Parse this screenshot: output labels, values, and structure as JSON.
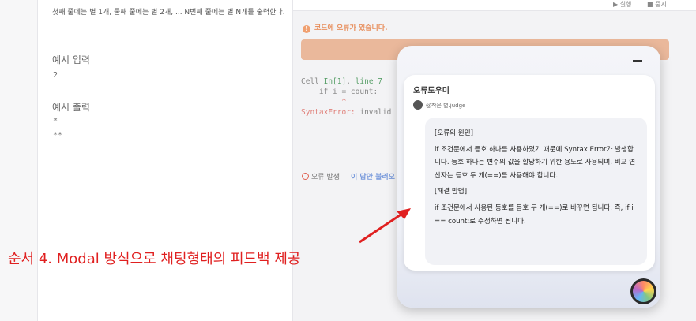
{
  "problem": {
    "description": "첫째 줄에는 별 1개, 둘째 줄에는 별 2개, ... N번째 줄에는 별 N개를 출력한다.",
    "example_input_title": "예시 입력",
    "example_input_value": "2",
    "example_output_title": "예시 출력",
    "example_output_line1": "*",
    "example_output_line2": "**"
  },
  "editor": {
    "run_label": "▶ 실행",
    "stop_label": "■ 중지",
    "error_header": "코드에 오류가 있습니다.",
    "console_line1": "Cell In[1], line 7",
    "console_line2": "    if i = count:",
    "console_line3": "         ^",
    "console_line4_prefix": "SyntaxError:",
    "console_line4_rest": " invalid",
    "error_chip": "오류 발생",
    "ai_link": "이 답안 불러오"
  },
  "modal": {
    "title": "오류도우미",
    "author": "@착은 별.judge",
    "cause_heading": "[오류의 원인]",
    "cause_text": "if 조건문에서 등호 하나를 사용하였기 때문에 Syntax Error가 발생합니다. 등호 하나는 변수의 값을 할당하기 위한 용도로 사용되며, 비교 연산자는 등호 두 개(==)를 사용해야 합니다.",
    "fix_heading": "[해결 방법]",
    "fix_text": "if 조건문에서 사용된 등호를 등호 두 개(==)로 바꾸면 됩니다. 즉, if i == count:로 수정하면 됩니다."
  },
  "annotation": {
    "text": "순서 4. Modal 방식으로 채팅형태의 피드백 제공",
    "color": "#e02020"
  }
}
